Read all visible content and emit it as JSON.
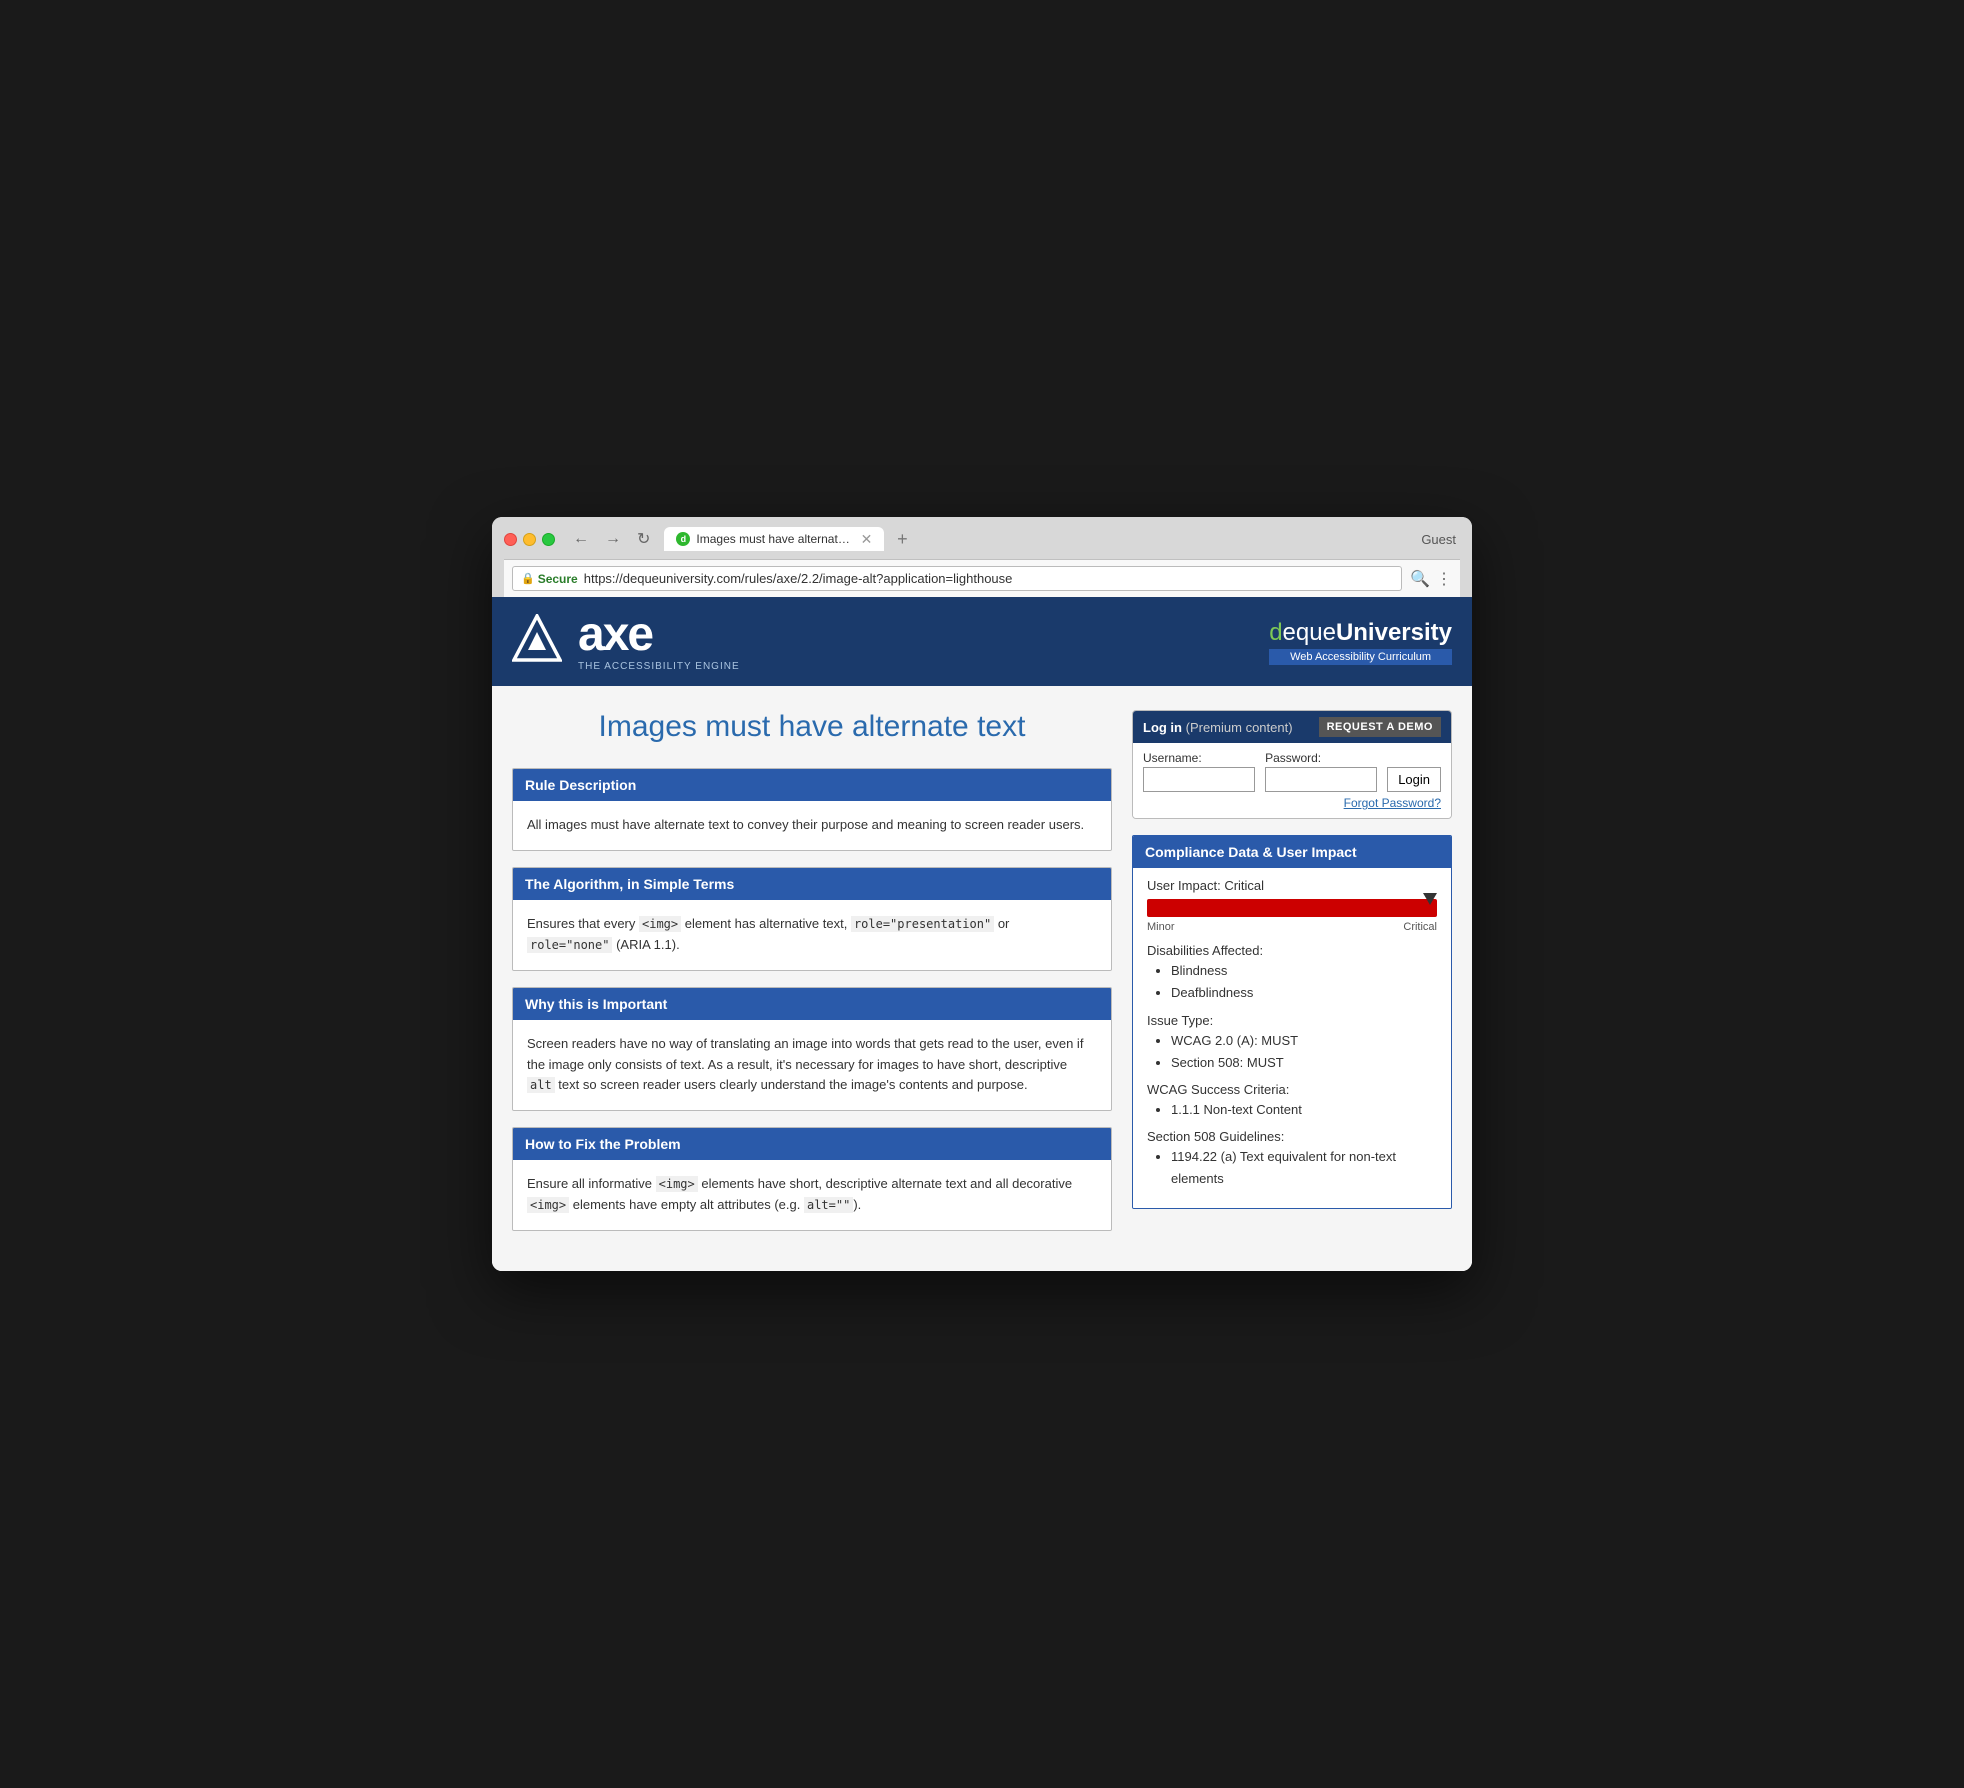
{
  "browser": {
    "tab_title": "Images must have alternate te…",
    "url_secure": "Secure",
    "url_full": "https://dequeuniversity.com/rules/axe/2.2/image-alt?application=lighthouse",
    "url_domain": "dequeuniversity.com",
    "url_path": "/rules/axe/2.2/image-alt?application=lighthouse",
    "guest_label": "Guest"
  },
  "header": {
    "logo_tagline": "THE ACCESSIBILITY ENGINE",
    "axe_text": "axe",
    "deque_prefix": "deque",
    "univ_text": "University",
    "curriculum": "Web Accessibility Curriculum"
  },
  "page": {
    "title": "Images must have alternate text"
  },
  "login": {
    "header_login": "Log in",
    "header_premium": "(Premium content)",
    "request_demo": "REQUEST A DEMO",
    "username_label": "Username:",
    "password_label": "Password:",
    "login_btn": "Login",
    "forgot_password": "Forgot Password?"
  },
  "sections": [
    {
      "id": "rule-description",
      "heading": "Rule Description",
      "body": "All images must have alternate text to convey their purpose and meaning to screen reader users."
    },
    {
      "id": "algorithm",
      "heading": "The Algorithm, in Simple Terms",
      "body_parts": [
        "Ensures that every ",
        "<img>",
        " element has alternative text, ",
        "role=\"presentation\"",
        " or ",
        "role=\"none\"",
        " (ARIA 1.1)."
      ]
    },
    {
      "id": "why-important",
      "heading": "Why this is Important",
      "body": "Screen readers have no way of translating an image into words that gets read to the user, even if the image only consists of text. As a result, it's necessary for images to have short, descriptive alt text so screen reader users clearly understand the image's contents and purpose."
    },
    {
      "id": "how-to-fix",
      "heading": "How to Fix the Problem",
      "body_parts": [
        "Ensure all informative ",
        "<img>",
        " elements have short, descriptive alternate text and all decorative ",
        "<img>",
        " elements have empty alt attributes (e.g. ",
        "alt=\"\"",
        ")."
      ]
    }
  ],
  "compliance": {
    "heading": "Compliance Data & User Impact",
    "user_impact_label": "User Impact:",
    "user_impact_value": "Critical",
    "impact_min": "Minor",
    "impact_max": "Critical",
    "disabilities_heading": "Disabilities Affected:",
    "disabilities": [
      "Blindness",
      "Deafblindness"
    ],
    "issue_type_heading": "Issue Type:",
    "issue_types": [
      "WCAG 2.0 (A): MUST",
      "Section 508: MUST"
    ],
    "wcag_heading": "WCAG Success Criteria:",
    "wcag_items": [
      "1.1.1 Non-text Content"
    ],
    "section508_heading": "Section 508 Guidelines:",
    "section508_items": [
      "1194.22 (a) Text equivalent for non-text elements"
    ]
  }
}
